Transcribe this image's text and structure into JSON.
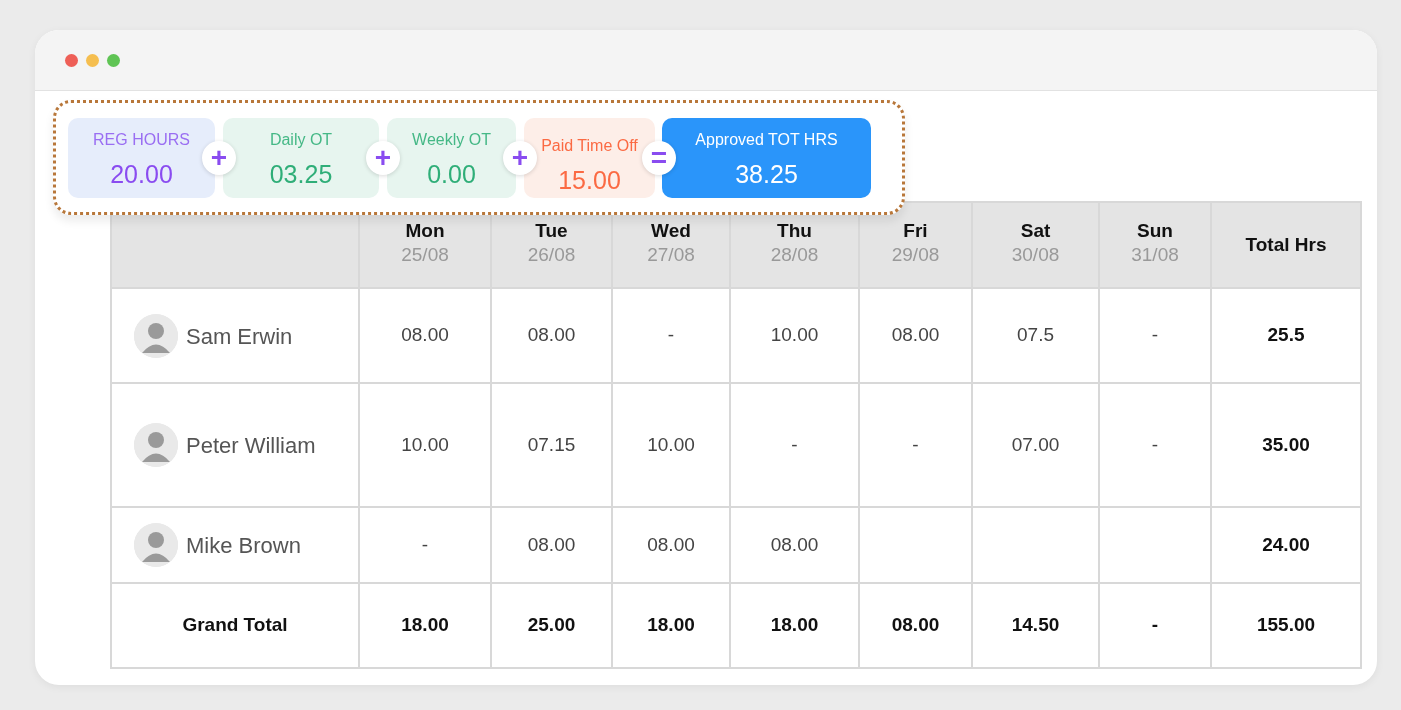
{
  "summary": [
    {
      "kind": "regular",
      "label": "REG HOURS",
      "value": "20.00",
      "operator": "+"
    },
    {
      "kind": "daily",
      "label": "Daily OT",
      "value": "03.25",
      "operator": "+"
    },
    {
      "kind": "weekly",
      "label": "Weekly OT",
      "value": "0.00",
      "operator": "+"
    },
    {
      "kind": "pto",
      "label": "Paid Time Off",
      "value": "15.00",
      "operator": "="
    },
    {
      "kind": "total",
      "label": "Approved TOT HRS",
      "value": "38.25"
    }
  ],
  "table": {
    "columns": [
      {
        "day": "Mon",
        "date": "25/08"
      },
      {
        "day": "Tue",
        "date": "26/08"
      },
      {
        "day": "Wed",
        "date": "27/08"
      },
      {
        "day": "Thu",
        "date": "28/08"
      },
      {
        "day": "Fri",
        "date": "29/08"
      },
      {
        "day": "Sat",
        "date": "30/08"
      },
      {
        "day": "Sun",
        "date": "31/08"
      },
      {
        "day": "Total Hrs"
      }
    ],
    "rows": [
      {
        "name": "Sam Erwin",
        "cells": [
          "08.00",
          "08.00",
          "-",
          "10.00",
          "08.00",
          "07.5",
          "-"
        ],
        "total": "25.5"
      },
      {
        "name": "Peter William",
        "cells": [
          "10.00",
          "07.15",
          "10.00",
          "-",
          "-",
          "07.00",
          "-"
        ],
        "total": "35.00"
      },
      {
        "name": "Mike Brown",
        "cells": [
          "-",
          "08.00",
          "08.00",
          "08.00",
          null,
          null,
          null
        ],
        "total": "24.00"
      }
    ],
    "grand_total": {
      "label": "Grand Total",
      "cells": [
        "18.00",
        "25.00",
        "18.00",
        "18.00",
        "08.00",
        "14.50",
        "-"
      ],
      "total": "155.00"
    }
  }
}
